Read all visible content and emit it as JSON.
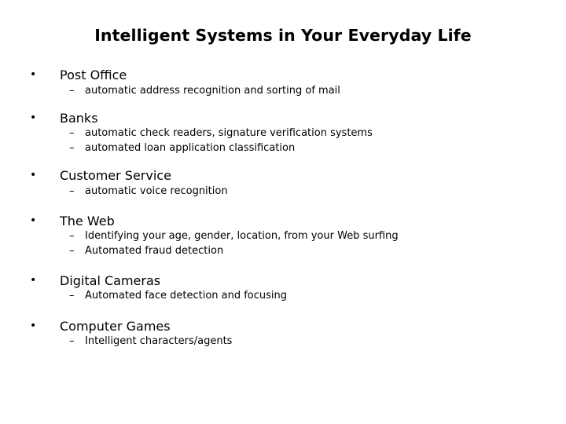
{
  "slide": {
    "title": "Intelligent Systems in Your Everyday Life",
    "bullet_glyph": "•",
    "dash_glyph": "–",
    "items": [
      {
        "heading": "Post Office",
        "subs": [
          "automatic address recognition and sorting of mail"
        ]
      },
      {
        "heading": "Banks",
        "subs": [
          "automatic check readers, signature verification systems",
          "automated loan application classification"
        ]
      },
      {
        "heading": "Customer Service",
        "subs": [
          "automatic voice recognition"
        ]
      },
      {
        "heading": "The Web",
        "subs": [
          "Identifying your age, gender, location, from your Web surfing",
          "Automated fraud detection"
        ]
      },
      {
        "heading": "Digital Cameras",
        "subs": [
          "Automated face detection and focusing"
        ]
      },
      {
        "heading": "Computer Games",
        "subs": [
          "Intelligent characters/agents"
        ]
      }
    ]
  }
}
